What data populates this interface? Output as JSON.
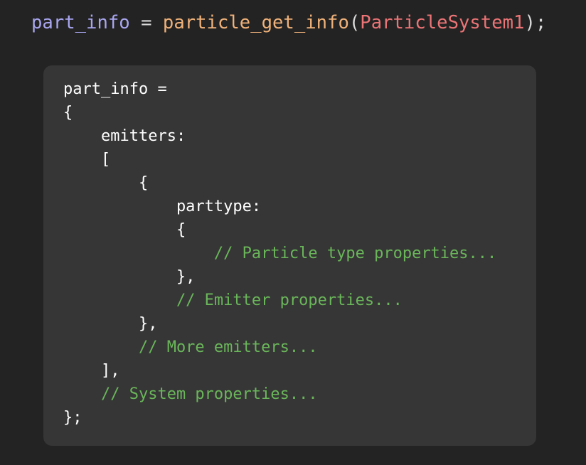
{
  "call": {
    "variable": "part_info",
    "operator": " = ",
    "function": "particle_get_info",
    "open_paren": "(",
    "argument": "ParticleSystem1",
    "close": ");"
  },
  "code_block": {
    "lines": [
      {
        "text": "part_info =",
        "kind": "code"
      },
      {
        "text": "{",
        "kind": "code"
      },
      {
        "text": "    emitters:",
        "kind": "code"
      },
      {
        "text": "    [",
        "kind": "code"
      },
      {
        "text": "        {",
        "kind": "code"
      },
      {
        "text": "            parttype:",
        "kind": "code"
      },
      {
        "text": "            {",
        "kind": "code"
      },
      {
        "text": "                // Particle type properties...",
        "kind": "comment"
      },
      {
        "text": "            },",
        "kind": "code"
      },
      {
        "text": "            // Emitter properties...",
        "kind": "comment"
      },
      {
        "text": "        },",
        "kind": "code"
      },
      {
        "text": "        // More emitters...",
        "kind": "comment"
      },
      {
        "text": "    ],",
        "kind": "code"
      },
      {
        "text": "    // System properties...",
        "kind": "comment"
      },
      {
        "text": "};",
        "kind": "code"
      }
    ]
  },
  "colors": {
    "background": "#232323",
    "panel": "#363636",
    "variable": "#a9a6f0",
    "function": "#f0b27a",
    "argument": "#ec7476",
    "comment": "#6ab65a",
    "code_text": "#ffffff"
  }
}
